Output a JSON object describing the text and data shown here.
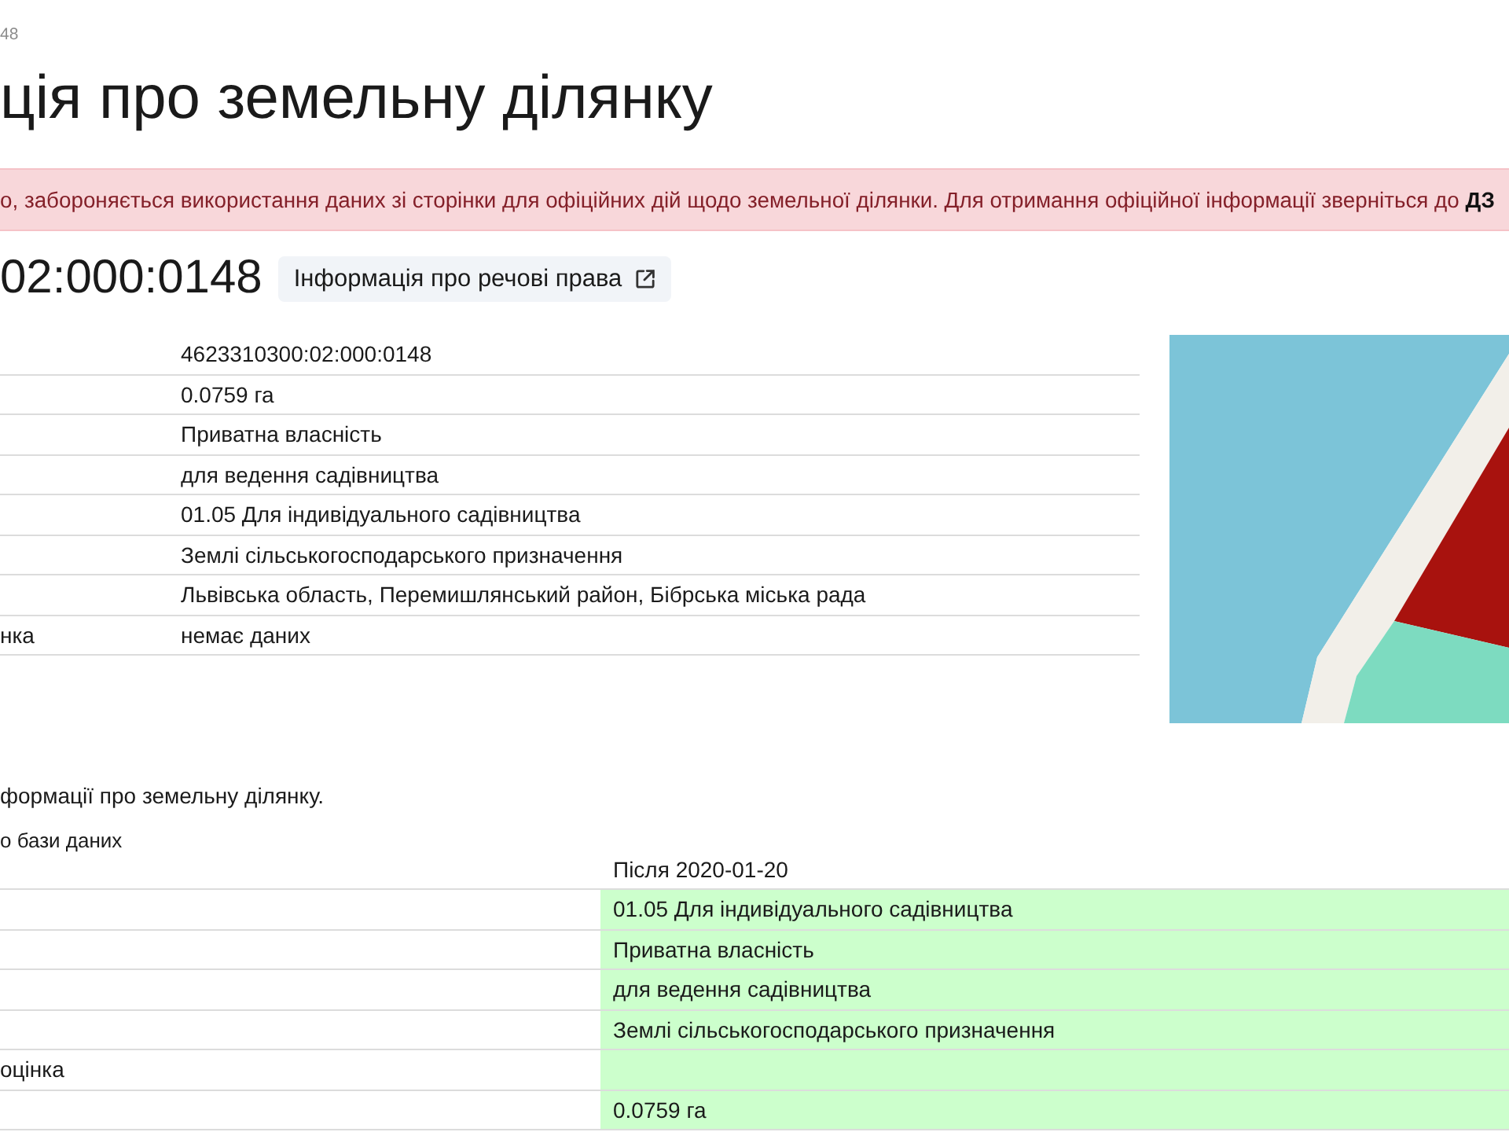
{
  "breadcrumb": {
    "text": "48"
  },
  "title": "ція про земельну ділянку",
  "alert": {
    "text": "о, забороняється використання даних зі сторінки для офіційних дій щодо земельної ділянки. Для отримання офіційної інформації зверніться до **ДЗ**"
  },
  "parcel_heading": {
    "number": "02:000:0148",
    "rights_link": "Інформація про речові права"
  },
  "details_table": {
    "rows": [
      {
        "value": "4623310300:02:000:0148"
      },
      {
        "value": "0.0759 га"
      },
      {
        "value": "Приватна власність"
      },
      {
        "value": "для ведення садівництва"
      },
      {
        "value": "01.05 Для індивідуального садівництва"
      },
      {
        "value": "Землі сільськогосподарського призначення"
      },
      {
        "value": "Львівська область, Перемишлянський район, Бібрська міська рада"
      },
      {
        "label": "нка",
        "value": "немає даних"
      }
    ]
  },
  "history": {
    "note": "формації про земельну ділянку.",
    "subtitle": "о бази даних",
    "table": {
      "after_header": "Після 2020-01-20",
      "rows": [
        {
          "after": "01.05 Для індивідуального садівництва",
          "highlighted": true
        },
        {
          "after": "Приватна власність",
          "highlighted": true
        },
        {
          "after": "для ведення садівництва",
          "highlighted": true
        },
        {
          "after": "Землі сільськогосподарського призначення",
          "highlighted": true
        },
        {
          "label": "оцінка",
          "highlighted": true
        },
        {
          "after": "0.0759 га",
          "highlighted": true
        }
      ]
    }
  }
}
